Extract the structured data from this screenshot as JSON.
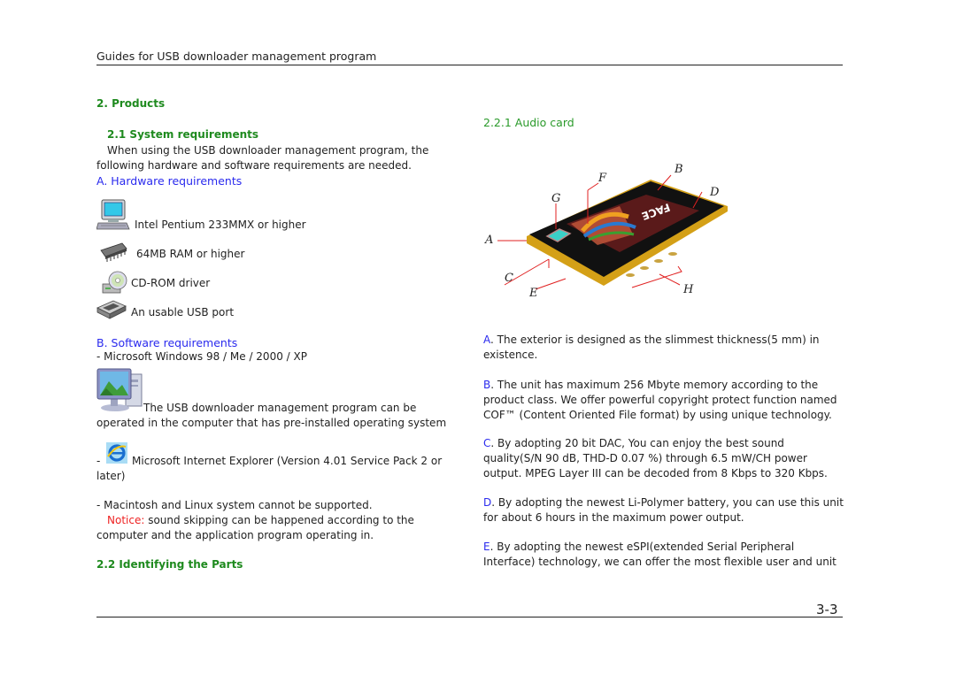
{
  "header": {
    "title": "Guides for USB downloader management program"
  },
  "section2": {
    "heading": "2. Products"
  },
  "sys_req": {
    "heading": "2.1 System requirements",
    "intro_line1": "When using the USB downloader management program, the",
    "intro_line2": "following hardware and software requirements are needed.",
    "hardware": {
      "heading": "A.  Hardware requirements",
      "items": [
        {
          "icon": "computer-icon",
          "label": "Intel Pentium 233MMX or higher"
        },
        {
          "icon": "ram-chip-icon",
          "label": "64MB RAM or higher"
        },
        {
          "icon": "cd-rom-icon",
          "label": "CD-ROM driver"
        },
        {
          "icon": "usb-port-icon",
          "label": "An usable USB port"
        }
      ]
    },
    "software": {
      "heading": "B. Software requirements",
      "os_line": "- Microsoft Windows 98 / Me / 2000 / XP",
      "os_desc_line1": "The USB downloader management program can be",
      "os_desc_line2": "operated in the computer that has pre-installed operating system",
      "ie_dash": "-",
      "ie_line1": "Microsoft Internet Explorer (Version 4.01 Service Pack 2 or",
      "ie_line2": "later)",
      "mac_line": "- Macintosh and Linux system cannot be supported.",
      "notice_label": "Notice:",
      "notice_line1": " sound skipping can be happened according to the",
      "notice_line2": "computer and the application program operating in."
    }
  },
  "identify": {
    "heading": "2.2 Identifying the Parts"
  },
  "audio_card": {
    "heading": "2.2.1 Audio card",
    "callouts": [
      "A",
      "B",
      "C",
      "D",
      "E",
      "F",
      "G",
      "H"
    ],
    "device_brand": "FACE",
    "features": [
      {
        "letter": "A",
        "text": ". The exterior is designed as the slimmest thickness(5 mm) in",
        "cont": [
          "existence."
        ]
      },
      {
        "letter": "B",
        "text": ". The unit has maximum 256 Mbyte memory according to the",
        "cont": [
          "product class. We offer powerful copyright protect function named",
          "COF™ (Content Oriented File format) by using unique technology."
        ]
      },
      {
        "letter": "C",
        "text": ". By adopting 20 bit DAC, You can enjoy the best sound",
        "cont": [
          "quality(S/N 90 dB, THD-D 0.07 %) through 6.5 mW/CH power",
          "output. MPEG Layer III can be decoded from 8 Kbps to 320 Kbps."
        ]
      },
      {
        "letter": "D",
        "text": ". By adopting the newest Li-Polymer battery, you can use this unit",
        "cont": [
          "for about 6 hours in the maximum power output."
        ]
      },
      {
        "letter": "E",
        "text": ". By adopting the newest eSPI(extended Serial Peripheral",
        "cont": [
          "Interface) technology, we can offer the most flexible user and unit"
        ]
      }
    ]
  },
  "footer": {
    "page_number": "3-3"
  }
}
